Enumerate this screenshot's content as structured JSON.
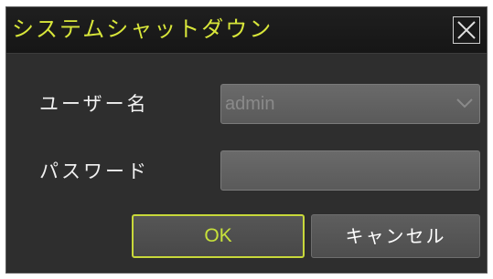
{
  "dialog": {
    "title": "システムシャットダウン",
    "close_icon": "close-icon"
  },
  "form": {
    "username_label": "ユーザー名",
    "username_value": "admin",
    "password_label": "パスワード",
    "password_value": ""
  },
  "buttons": {
    "ok_label": "OK",
    "cancel_label": "キャンセル"
  },
  "colors": {
    "title_text": "#d8e63a",
    "ok_border": "#c8d83a",
    "dialog_background": "#2e2e2e"
  }
}
